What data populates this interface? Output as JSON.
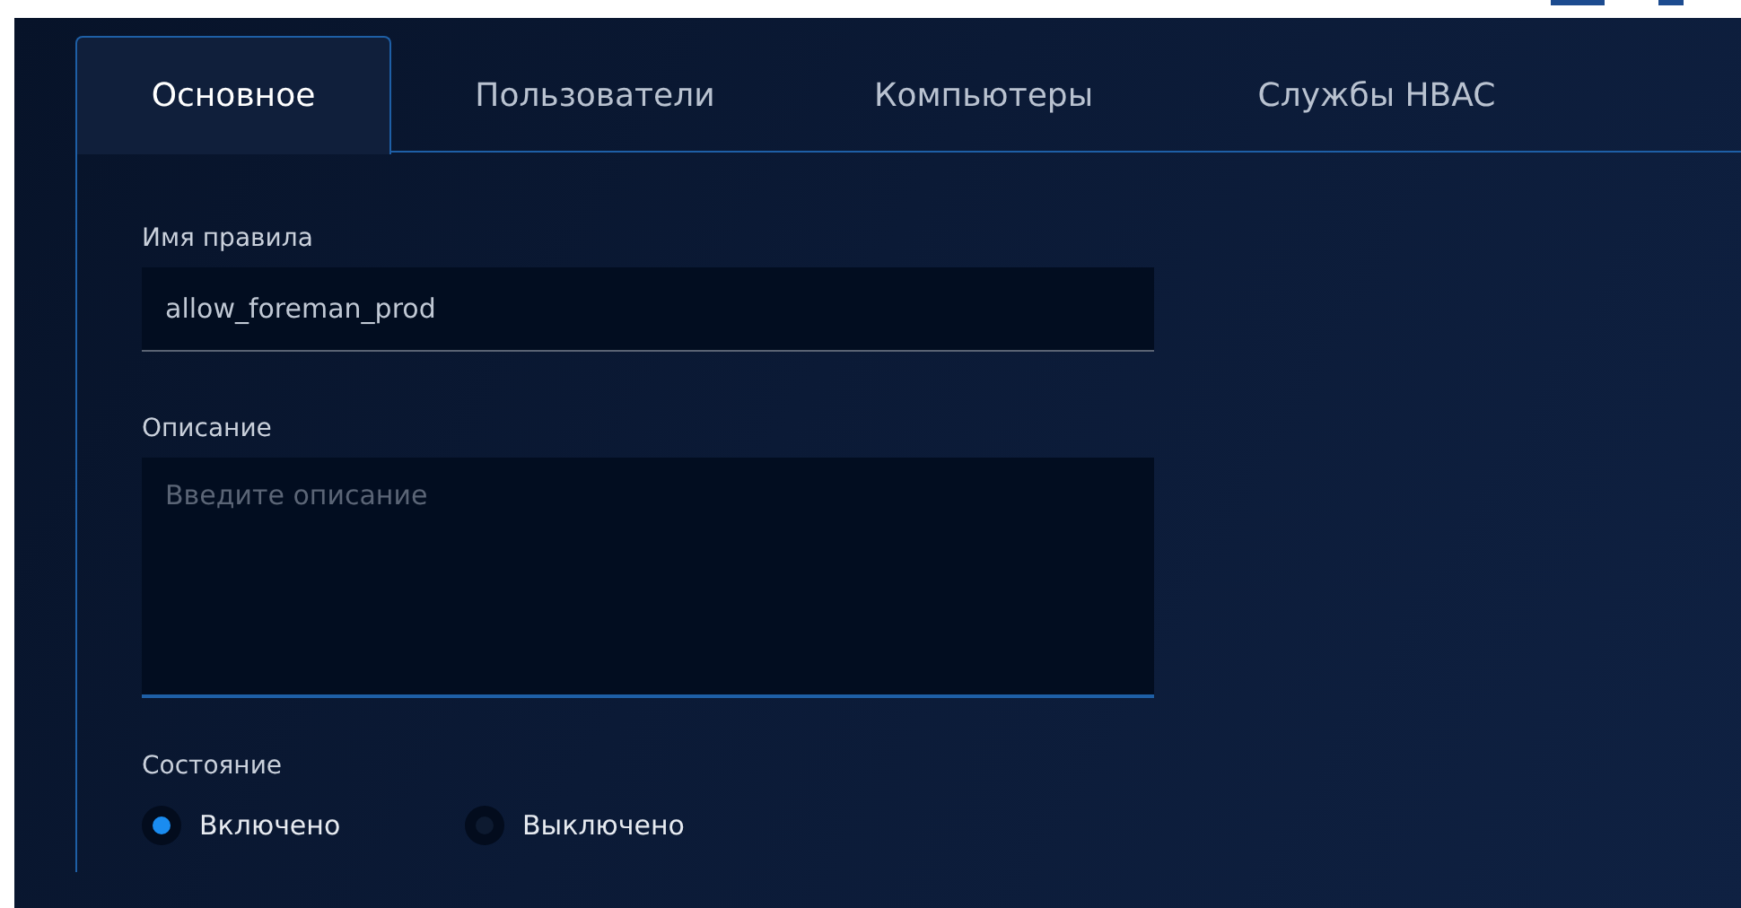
{
  "tabs": [
    {
      "label": "Основное",
      "selected": true
    },
    {
      "label": "Пользователи",
      "selected": false
    },
    {
      "label": "Компьютеры",
      "selected": false
    },
    {
      "label": "Службы HBAC",
      "selected": false
    }
  ],
  "form": {
    "name_label": "Имя правила",
    "name_value": "allow_foreman_prod",
    "description_label": "Описание",
    "description_placeholder": "Введите описание",
    "state_label": "Состояние",
    "state_options": [
      {
        "label": "Включено",
        "selected": true
      },
      {
        "label": "Выключено",
        "selected": false
      }
    ]
  }
}
